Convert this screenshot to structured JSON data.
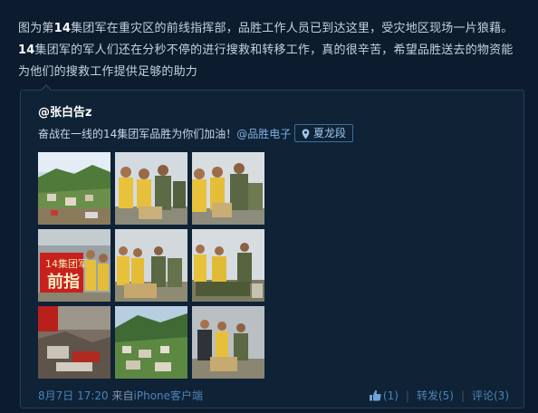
{
  "post": {
    "text_1": "图为第",
    "text_hl1": "14",
    "text_2": "集团军在重灾区的前线指挥部，品胜工作人员已到达这里，受灾地区现场一片狼藉。",
    "text_hl2": "14",
    "text_3": "集团军的军人们还在分秒不停的进行搜救和转移工作，真的很辛苦，希望品胜送去的物资能为他们的搜救工作提供足够的助力"
  },
  "retweet": {
    "author": "@张白告z",
    "text": "奋战在一线的14集团军品胜为你们加油！",
    "mention": "@品胜电子",
    "location": "夏龙段",
    "banner_text": "14集团军",
    "banner_text2": "前指",
    "footer": {
      "time": "8月7日 17:20",
      "from_label": "来自",
      "source": "iPhone客户端"
    },
    "actions": {
      "like": "(1)",
      "repost": "转发(5)",
      "comment": "评论(3)"
    }
  },
  "colors": {
    "background": "#0c1c2e",
    "link": "#4d83b8",
    "banner_red": "#c8201e"
  },
  "icons": [
    "location-pin-icon",
    "like-thumb-icon"
  ]
}
